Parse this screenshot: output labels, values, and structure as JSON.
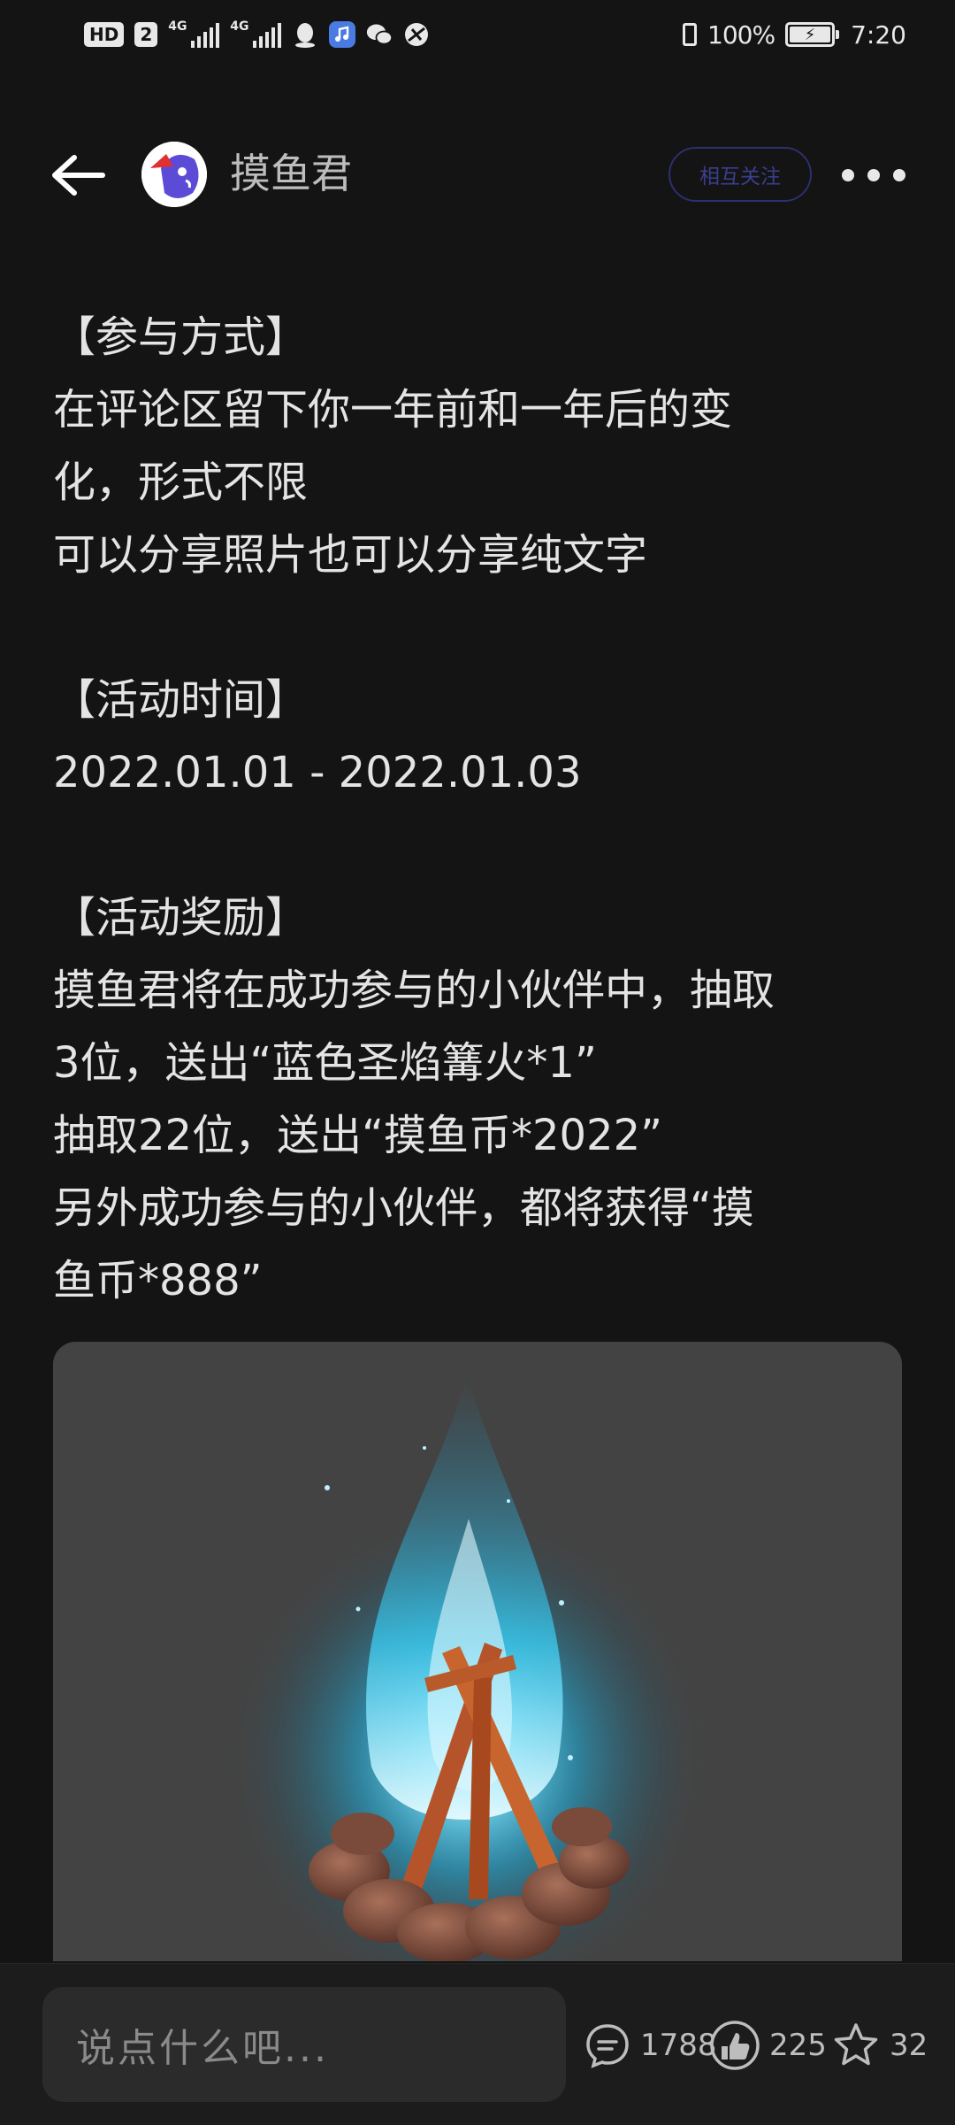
{
  "status_bar": {
    "hd_label": "HD",
    "sim_label": "2",
    "signal1_label": "4G",
    "signal2_label": "4G",
    "battery_percent": "100%",
    "time": "7:20",
    "app_icons": [
      "qq-icon",
      "music-icon",
      "wechat-icon",
      "browser-icon"
    ]
  },
  "header": {
    "author_name": "摸鱼君",
    "follow_label": "相互关注",
    "follow_color": "#2d2f6e"
  },
  "post": {
    "sections": [
      {
        "heading": "【参与方式】",
        "lines": [
          "在评论区留下你一年前和一年后的变",
          "化，形式不限",
          "可以分享照片也可以分享纯文字"
        ]
      },
      {
        "heading": "【活动时间】",
        "lines": [
          "2022.01.01 - 2022.01.03"
        ]
      },
      {
        "heading": "【活动奖励】",
        "lines": [
          "摸鱼君将在成功参与的小伙伴中，抽取",
          "3位，送出“蓝色圣焰篝火*1”",
          "抽取22位，送出“摸鱼币*2022”",
          "另外成功参与的小伙伴，都将获得“摸",
          "鱼币*888”"
        ]
      }
    ],
    "image": {
      "subject": "blue-campfire-image",
      "flame_color": "#38c8f0"
    }
  },
  "bottom_bar": {
    "comment_placeholder": "说点什么吧...",
    "comment_count": "1788",
    "like_count": "225",
    "favorite_count": "32"
  }
}
